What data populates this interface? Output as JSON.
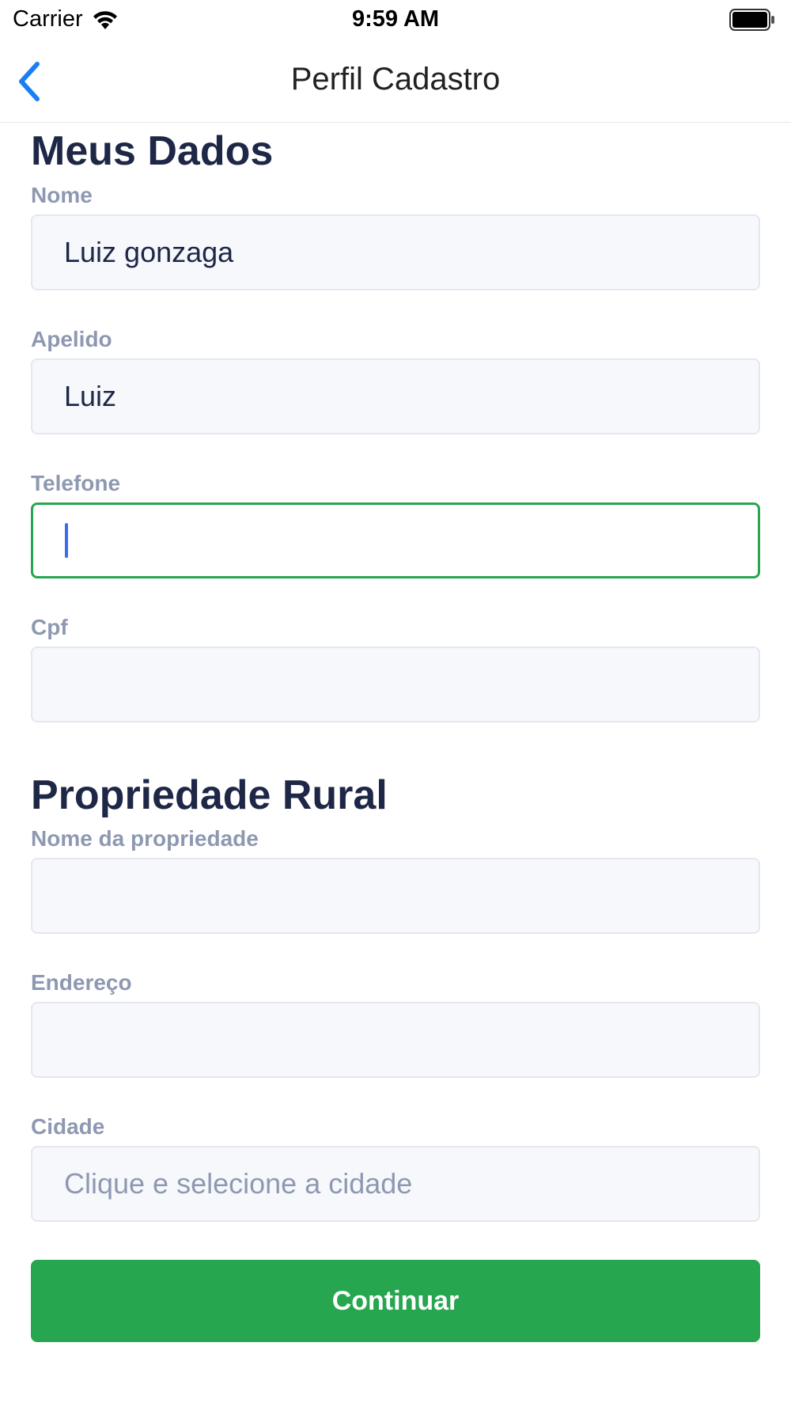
{
  "status_bar": {
    "carrier": "Carrier",
    "time": "9:59 AM"
  },
  "nav": {
    "title": "Perfil Cadastro"
  },
  "personal": {
    "title": "Meus Dados",
    "fields": [
      {
        "label": "Nome",
        "value": "Luiz gonzaga"
      },
      {
        "label": "Apelido",
        "value": "Luiz"
      },
      {
        "label": "Telefone",
        "value": ""
      },
      {
        "label": "Cpf",
        "value": ""
      }
    ]
  },
  "property": {
    "title": "Propriedade Rural",
    "fields": [
      {
        "label": "Nome da propriedade",
        "value": ""
      },
      {
        "label": "Endereço",
        "value": ""
      },
      {
        "label": "Cidade",
        "value": "",
        "placeholder": "Clique e selecione a cidade"
      }
    ]
  },
  "actions": {
    "continue_label": "Continuar"
  },
  "colors": {
    "accent": "#27a650",
    "back_arrow": "#1a7ef5",
    "label": "#8e99b1",
    "heading": "#1e2746"
  }
}
